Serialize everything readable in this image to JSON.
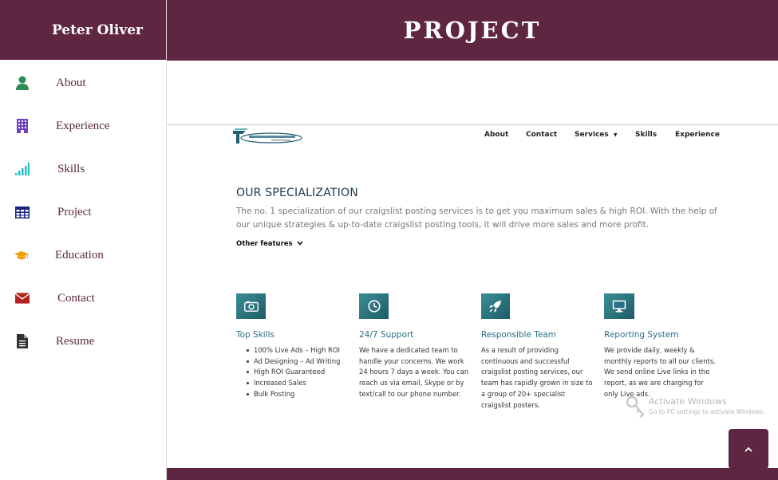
{
  "sidebar": {
    "name": "Peter Oliver",
    "items": [
      {
        "label": "About",
        "icon": "user-icon",
        "color": "#2e8b57"
      },
      {
        "label": "Experience",
        "icon": "building-icon",
        "color": "#6f42c1"
      },
      {
        "label": "Skills",
        "icon": "signal-icon",
        "color": "#20c0c0"
      },
      {
        "label": "Project",
        "icon": "table-icon",
        "color": "#1a237e"
      },
      {
        "label": "Education",
        "icon": "graduation-cap-icon",
        "color": "#f0a000"
      },
      {
        "label": "Contact",
        "icon": "envelope-icon",
        "color": "#b22222"
      },
      {
        "label": "Resume",
        "icon": "file-icon",
        "color": "#333333"
      }
    ]
  },
  "header": {
    "title": "PROJECT"
  },
  "site": {
    "nav": [
      "About",
      "Contact",
      "Services",
      "Skills",
      "Experience"
    ],
    "section_title": "OUR SPECIALIZATION",
    "section_body": "The no. 1 specialization of our craigslist posting services is to get you maximum sales & high ROI. With the help of our unique strategies & up-to-date craigslist posting tools, it will drive more sales and more profit.",
    "other_features": "Other features",
    "features": [
      {
        "title": "Top Skills",
        "icon": "camera-icon",
        "list": [
          "100% Live Ads – High ROI",
          "Ad Designing – Ad Writing",
          "High ROI Guaranteed",
          "Increased Sales",
          "Bulk Posting"
        ]
      },
      {
        "title": "24/7 Support",
        "icon": "clock-icon",
        "text": "We have a dedicated team to handle your concerns. We work 24 hours 7 days a week. You can reach us via email, Skype or by text/call to our phone number."
      },
      {
        "title": "Responsible Team",
        "icon": "rocket-icon",
        "text": "As a result of providing continuous and successful craigslist posting services, our team has rapidly grown in size to a group of 20+ specialist craigslist posters."
      },
      {
        "title": "Reporting System",
        "icon": "monitor-icon",
        "text": "We provide daily, weekly & monthly reports to all our clients. We send online Live links in the report, as we are charging for only Live ads."
      }
    ]
  },
  "watermark": {
    "title": "Activate Windows",
    "subtitle": "Go to PC settings to activate Windows."
  },
  "colors": {
    "brand": "#5e2640",
    "accent": "#2b6d8a"
  }
}
